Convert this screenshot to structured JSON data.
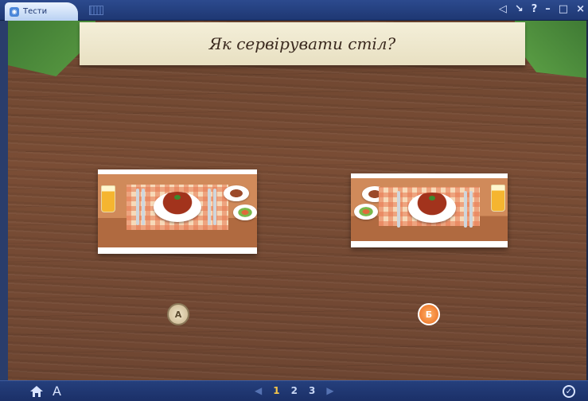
{
  "window": {
    "tab_label": "Тести",
    "controls": [
      "◁",
      "↘",
      "?",
      "–",
      "□",
      "×"
    ]
  },
  "question": {
    "title": "Як сервірувати стіл?"
  },
  "options": [
    {
      "letter": "А",
      "selected": false
    },
    {
      "letter": "Б",
      "selected": true
    }
  ],
  "footer": {
    "font_label": "A",
    "pages": [
      "1",
      "2",
      "3"
    ],
    "current_page": "1",
    "prev_symbol": "◀",
    "next_symbol": "▶"
  },
  "icons": [
    "app-tab-icon",
    "grid-view-icon",
    "home-icon",
    "check-icon"
  ],
  "colors": {
    "accent": "#ea6b1e",
    "bar": "#1e3772",
    "banner": "#f4efd9"
  }
}
